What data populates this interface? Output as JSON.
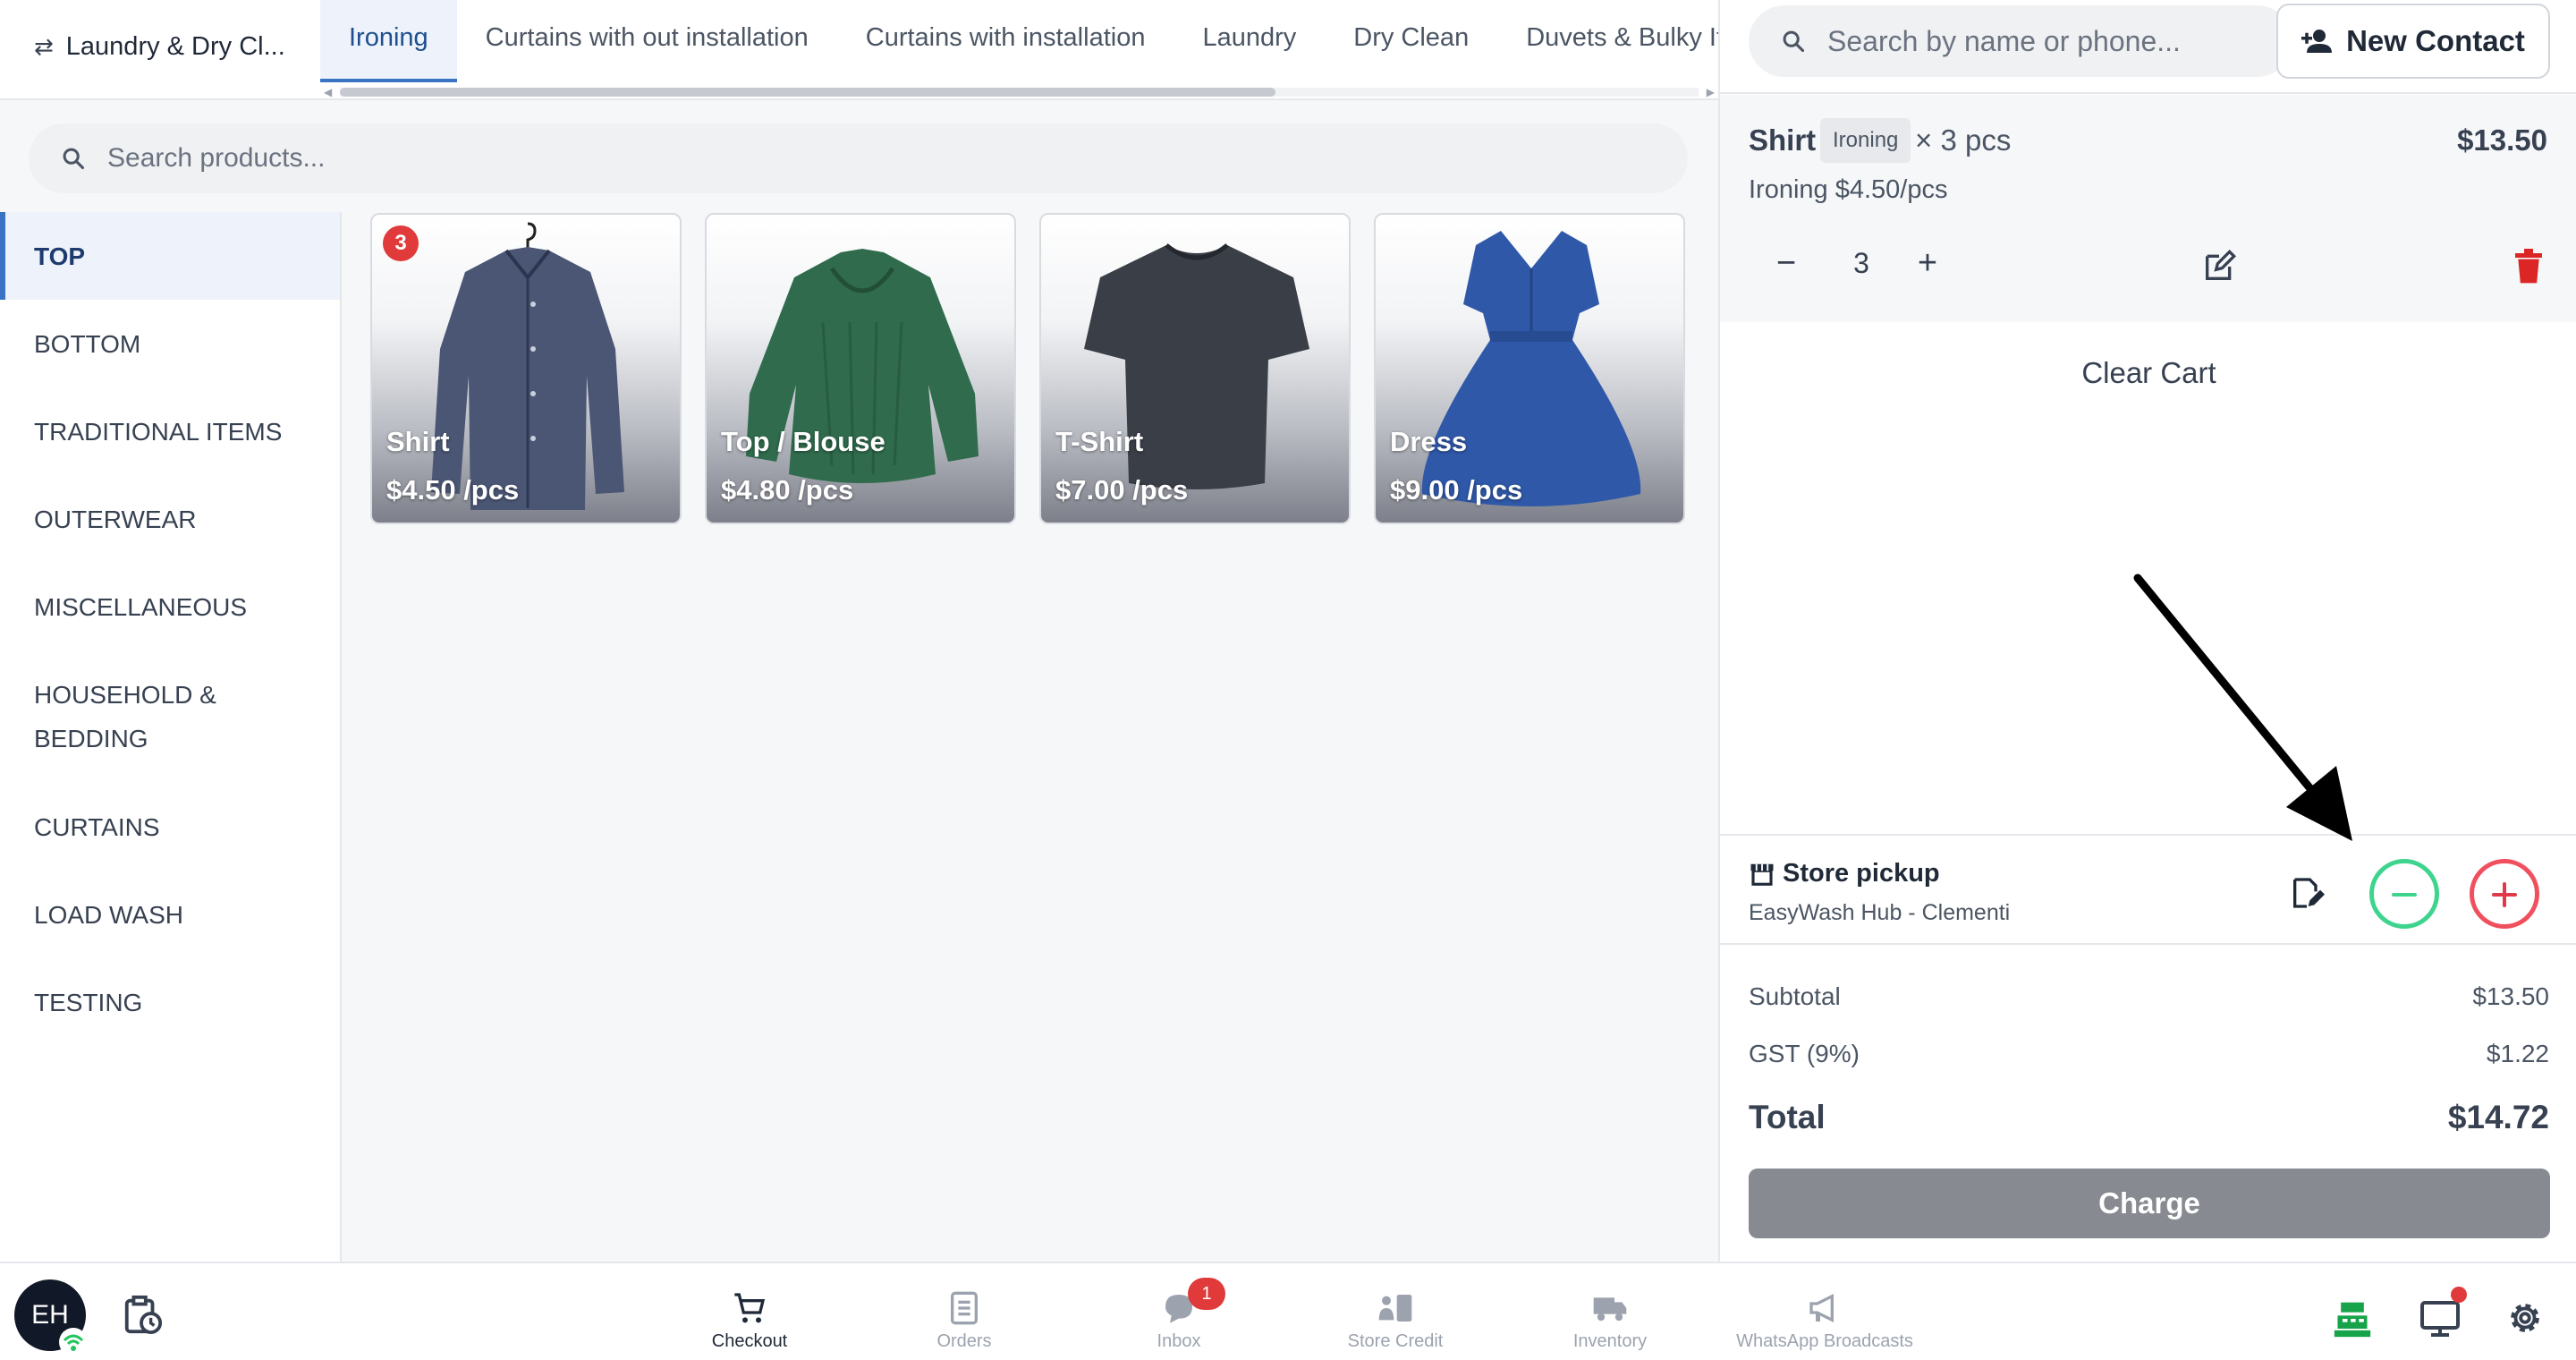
{
  "business": {
    "name": "Laundry & Dry Cl..."
  },
  "tabs": [
    "Ironing",
    "Curtains with out installation",
    "Curtains with installation",
    "Laundry",
    "Dry Clean",
    "Duvets & Bulky Items"
  ],
  "product_search": {
    "placeholder": "Search products..."
  },
  "categories": [
    "TOP",
    "BOTTOM",
    "TRADITIONAL ITEMS",
    "OUTERWEAR",
    "MISCELLANEOUS",
    "HOUSEHOLD & BEDDING",
    "CURTAINS",
    "LOAD WASH",
    "TESTING"
  ],
  "products": [
    {
      "name": "Shirt",
      "price": "$4.50 /pcs",
      "badge": "3"
    },
    {
      "name": "Top / Blouse",
      "price": "$4.80 /pcs"
    },
    {
      "name": "T-Shirt",
      "price": "$7.00 /pcs"
    },
    {
      "name": "Dress",
      "price": "$9.00 /pcs"
    }
  ],
  "contact_search": {
    "placeholder": "Search by name or phone..."
  },
  "new_contact_label": "New Contact",
  "cart_item": {
    "name": "Shirt",
    "service": "Ironing",
    "qty_text": "× 3 pcs",
    "price": "$13.50",
    "unit": "Ironing $4.50/pcs",
    "qty": "3"
  },
  "clear_cart_label": "Clear Cart",
  "pickup": {
    "title": "Store pickup",
    "address": "EasyWash Hub - Clementi"
  },
  "summary": {
    "subtotal_label": "Subtotal",
    "subtotal": "$13.50",
    "gst_label": "GST (9%)",
    "gst": "$1.22",
    "total_label": "Total",
    "total": "$14.72"
  },
  "charge_label": "Charge",
  "user": {
    "initials": "EH"
  },
  "nav": [
    {
      "label": "Checkout",
      "icon": "cart-icon"
    },
    {
      "label": "Orders",
      "icon": "document-icon"
    },
    {
      "label": "Inbox",
      "icon": "chat-icon",
      "badge": "1"
    },
    {
      "label": "Store Credit",
      "icon": "wallet-icon"
    },
    {
      "label": "Inventory",
      "icon": "truck-icon"
    },
    {
      "label": "WhatsApp Broadcasts",
      "icon": "megaphone-icon"
    }
  ],
  "colors": {
    "accent": "#3b73c4",
    "badge": "#e03a3a",
    "collapse": "#3fd48e",
    "expand": "#f0505e",
    "charge": "#878a91"
  }
}
